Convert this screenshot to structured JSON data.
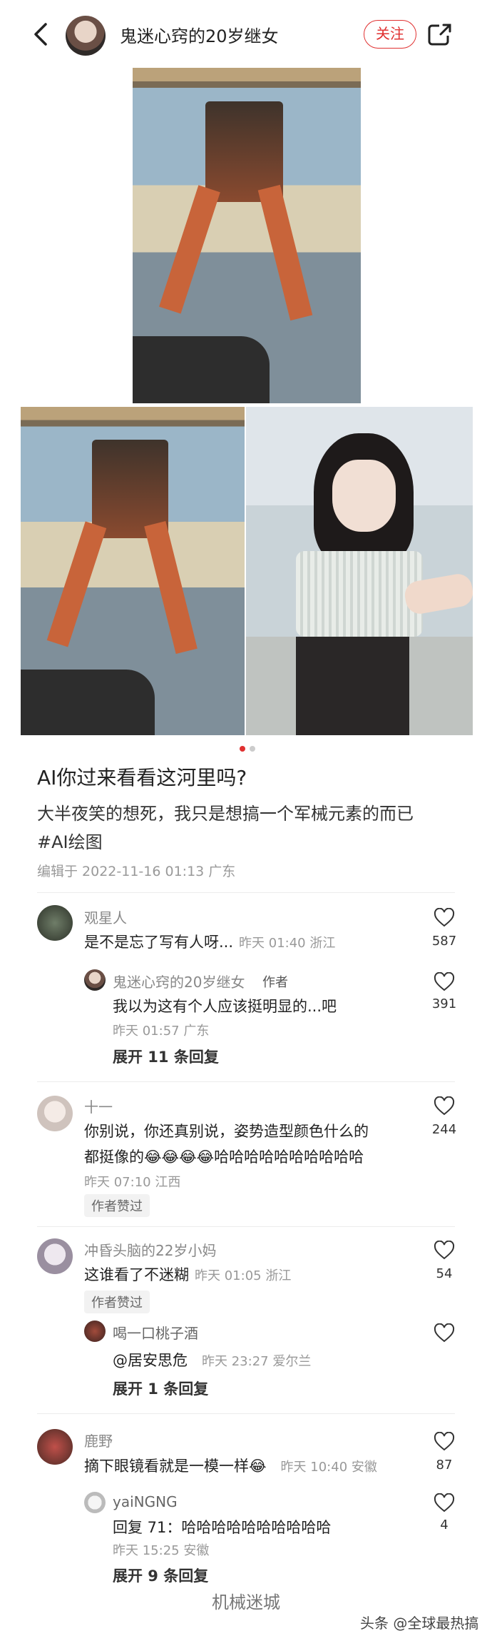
{
  "header": {
    "author_name": "鬼迷心窍的20岁继女",
    "follow_label": "关注"
  },
  "carousel": {
    "total": 2,
    "active_index": 0
  },
  "post": {
    "title": "AI你过来看看这河里吗?",
    "body_line1": "大半夜笑的想死，我只是想搞一个军械元素的而已",
    "hashtag": "#AI绘图",
    "edit_info": "编辑于 2022-11-16 01:13 广东"
  },
  "comments": [
    {
      "name": "观星人",
      "text": "是不是忘了写有人呀...",
      "meta": "昨天 01:40 浙江",
      "likes": "587",
      "reply": {
        "name": "鬼迷心窍的20岁继女",
        "tag": "作者",
        "text": "我以为这有个人应该挺明显的...吧",
        "meta": "昨天 01:57 广东",
        "likes": "391"
      },
      "expand": "展开 11 条回复"
    },
    {
      "name": "十一",
      "text_line1": "你别说，你还真别说，姿势造型颜色什么的",
      "text_line2": "都挺像的😂😂😂😂哈哈哈哈哈哈哈哈哈哈",
      "meta": "昨天 07:10 江西",
      "likes": "244",
      "liked_by_author": "作者赞过"
    },
    {
      "name": "冲昏头脑的22岁小妈",
      "text": "这谁看了不迷糊",
      "meta": "昨天 01:05 浙江",
      "likes": "54",
      "liked_by_author": "作者赞过",
      "reply": {
        "name": "喝一口桃子酒",
        "text": "@居安思危",
        "meta": "昨天 23:27 爱尔兰"
      },
      "expand": "展开 1 条回复"
    },
    {
      "name": "鹿野",
      "text": "摘下眼镜看就是一模一样😂",
      "meta": "昨天 10:40 安徽",
      "likes": "87",
      "reply": {
        "name": "yaiNGNG",
        "text": "回复 71：哈哈哈哈哈哈哈哈哈哈",
        "meta": "昨天 15:25 安徽",
        "likes": "4"
      },
      "expand": "展开 9 条回复"
    }
  ],
  "watermark": "机械迷城",
  "source_tag": "头条 @全球最热搞笑"
}
